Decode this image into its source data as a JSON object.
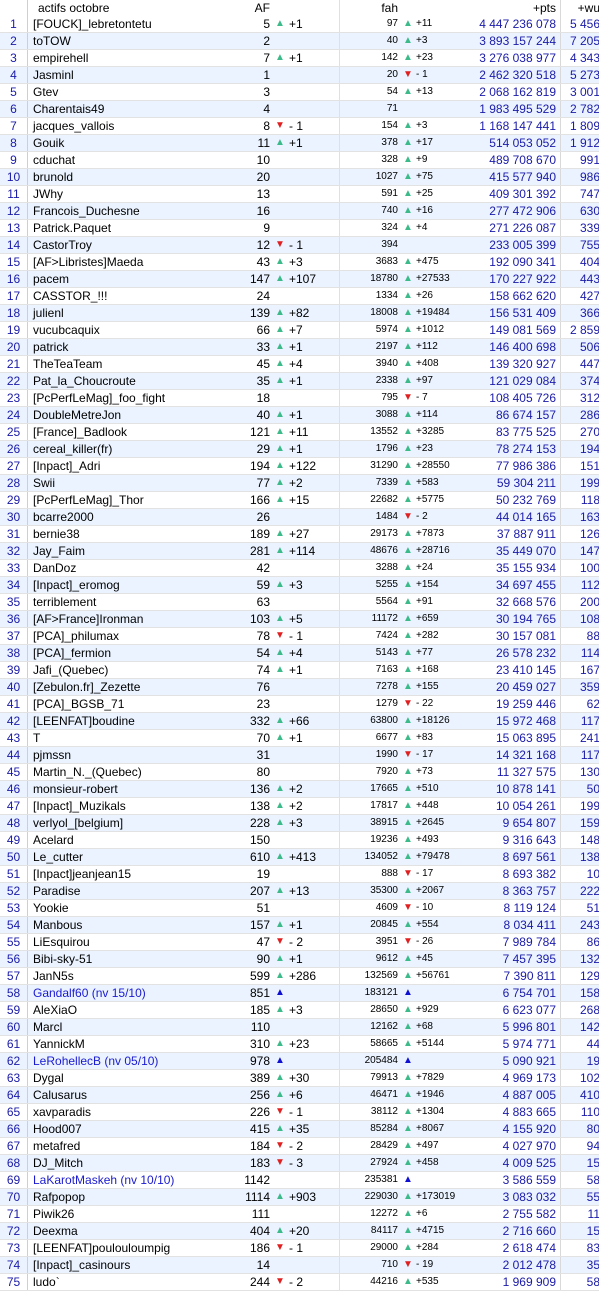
{
  "header": {
    "col_actifs": "actifs octobre",
    "col_af": "AF",
    "col_fah": "fah",
    "col_pts": "+pts",
    "col_wu": "+wu"
  },
  "rows": [
    {
      "r": "1",
      "n": "[FOUCK]_lebretontetu",
      "af": "5",
      "afa": "up",
      "afd": "+1",
      "f": "97",
      "fa": "up",
      "fd": "+11",
      "p": "4 447 236 078",
      "w": "5 456"
    },
    {
      "r": "2",
      "n": "toTOW",
      "af": "2",
      "afa": "",
      "afd": "",
      "f": "40",
      "fa": "up",
      "fd": "+3",
      "p": "3 893 157 244",
      "w": "7 205"
    },
    {
      "r": "3",
      "n": "empirehell",
      "af": "7",
      "afa": "up",
      "afd": "+1",
      "f": "142",
      "fa": "up",
      "fd": "+23",
      "p": "3 276 038 977",
      "w": "4 343"
    },
    {
      "r": "4",
      "n": "Jasminl",
      "af": "1",
      "afa": "",
      "afd": "",
      "f": "20",
      "fa": "down",
      "fd": "- 1",
      "p": "2 462 320 518",
      "w": "5 273"
    },
    {
      "r": "5",
      "n": "Gtev",
      "af": "3",
      "afa": "",
      "afd": "",
      "f": "54",
      "fa": "up",
      "fd": "+13",
      "p": "2 068 162 819",
      "w": "3 001"
    },
    {
      "r": "6",
      "n": "Charentais49",
      "af": "4",
      "afa": "",
      "afd": "",
      "f": "71",
      "fa": "",
      "fd": "",
      "p": "1 983 495 529",
      "w": "2 782"
    },
    {
      "r": "7",
      "n": "jacques_vallois",
      "af": "8",
      "afa": "down",
      "afd": "- 1",
      "f": "154",
      "fa": "up",
      "fd": "+3",
      "p": "1 168 147 441",
      "w": "1 809"
    },
    {
      "r": "8",
      "n": "Gouik",
      "af": "11",
      "afa": "up",
      "afd": "+1",
      "f": "378",
      "fa": "up",
      "fd": "+17",
      "p": "514 053 052",
      "w": "1 912"
    },
    {
      "r": "9",
      "n": "cduchat",
      "af": "10",
      "afa": "",
      "afd": "",
      "f": "328",
      "fa": "up",
      "fd": "+9",
      "p": "489 708 670",
      "w": "991"
    },
    {
      "r": "10",
      "n": "brunold",
      "af": "20",
      "afa": "",
      "afd": "",
      "f": "1027",
      "fa": "up",
      "fd": "+75",
      "p": "415 577 940",
      "w": "986"
    },
    {
      "r": "11",
      "n": "JWhy",
      "af": "13",
      "afa": "",
      "afd": "",
      "f": "591",
      "fa": "up",
      "fd": "+25",
      "p": "409 301 392",
      "w": "747"
    },
    {
      "r": "12",
      "n": "Francois_Duchesne",
      "af": "16",
      "afa": "",
      "afd": "",
      "f": "740",
      "fa": "up",
      "fd": "+16",
      "p": "277 472 906",
      "w": "630"
    },
    {
      "r": "13",
      "n": "Patrick.Paquet",
      "af": "9",
      "afa": "",
      "afd": "",
      "f": "324",
      "fa": "up",
      "fd": "+4",
      "p": "271 226 087",
      "w": "339"
    },
    {
      "r": "14",
      "n": "CastorTroy",
      "af": "12",
      "afa": "down",
      "afd": "- 1",
      "f": "394",
      "fa": "",
      "fd": "",
      "p": "233 005 399",
      "w": "755"
    },
    {
      "r": "15",
      "n": "[AF>Libristes]Maeda",
      "af": "43",
      "afa": "up",
      "afd": "+3",
      "f": "3683",
      "fa": "up",
      "fd": "+475",
      "p": "192 090 341",
      "w": "404"
    },
    {
      "r": "16",
      "n": "pacem",
      "af": "147",
      "afa": "up",
      "afd": "+107",
      "f": "18780",
      "fa": "up",
      "fd": "+27533",
      "p": "170 227 922",
      "w": "443"
    },
    {
      "r": "17",
      "n": "CASSTOR_!!!",
      "af": "24",
      "afa": "",
      "afd": "",
      "f": "1334",
      "fa": "up",
      "fd": "+26",
      "p": "158 662 620",
      "w": "427"
    },
    {
      "r": "18",
      "n": "julienl",
      "af": "139",
      "afa": "up",
      "afd": "+82",
      "f": "18008",
      "fa": "up",
      "fd": "+19484",
      "p": "156 531 409",
      "w": "366"
    },
    {
      "r": "19",
      "n": "vucubcaquix",
      "af": "66",
      "afa": "up",
      "afd": "+7",
      "f": "5974",
      "fa": "up",
      "fd": "+1012",
      "p": "149 081 569",
      "w": "2 859"
    },
    {
      "r": "20",
      "n": "patrick",
      "af": "33",
      "afa": "up",
      "afd": "+1",
      "f": "2197",
      "fa": "up",
      "fd": "+112",
      "p": "146 400 698",
      "w": "506"
    },
    {
      "r": "21",
      "n": "TheTeaTeam",
      "af": "45",
      "afa": "up",
      "afd": "+4",
      "f": "3940",
      "fa": "up",
      "fd": "+408",
      "p": "139 320 927",
      "w": "447"
    },
    {
      "r": "22",
      "n": "Pat_la_Choucroute",
      "af": "35",
      "afa": "up",
      "afd": "+1",
      "f": "2338",
      "fa": "up",
      "fd": "+97",
      "p": "121 029 084",
      "w": "374"
    },
    {
      "r": "23",
      "n": "[PcPerfLeMag]_foo_fight",
      "af": "18",
      "afa": "",
      "afd": "",
      "f": "795",
      "fa": "down",
      "fd": "- 7",
      "p": "108 405 726",
      "w": "312"
    },
    {
      "r": "24",
      "n": "DoubleMetreJon",
      "af": "40",
      "afa": "up",
      "afd": "+1",
      "f": "3088",
      "fa": "up",
      "fd": "+114",
      "p": "86 674 157",
      "w": "286"
    },
    {
      "r": "25",
      "n": "[France]_Badlook",
      "af": "121",
      "afa": "up",
      "afd": "+11",
      "f": "13552",
      "fa": "up",
      "fd": "+3285",
      "p": "83 775 525",
      "w": "270"
    },
    {
      "r": "26",
      "n": "cereal_killer(fr)",
      "af": "29",
      "afa": "up",
      "afd": "+1",
      "f": "1796",
      "fa": "up",
      "fd": "+23",
      "p": "78 274 153",
      "w": "194"
    },
    {
      "r": "27",
      "n": "[Inpact]_Adri",
      "af": "194",
      "afa": "up",
      "afd": "+122",
      "f": "31290",
      "fa": "up",
      "fd": "+28550",
      "p": "77 986 386",
      "w": "151"
    },
    {
      "r": "28",
      "n": "Swii",
      "af": "77",
      "afa": "up",
      "afd": "+2",
      "f": "7339",
      "fa": "up",
      "fd": "+583",
      "p": "59 304 211",
      "w": "199"
    },
    {
      "r": "29",
      "n": "[PcPerfLeMag]_Thor",
      "af": "166",
      "afa": "up",
      "afd": "+15",
      "f": "22682",
      "fa": "up",
      "fd": "+5775",
      "p": "50 232 769",
      "w": "118"
    },
    {
      "r": "30",
      "n": "bcarre2000",
      "af": "26",
      "afa": "",
      "afd": "",
      "f": "1484",
      "fa": "down",
      "fd": "- 2",
      "p": "44 014 165",
      "w": "163"
    },
    {
      "r": "31",
      "n": "bernie38",
      "af": "189",
      "afa": "up",
      "afd": "+27",
      "f": "29173",
      "fa": "up",
      "fd": "+7873",
      "p": "37 887 911",
      "w": "126"
    },
    {
      "r": "32",
      "n": "Jay_Faim",
      "af": "281",
      "afa": "up",
      "afd": "+114",
      "f": "48676",
      "fa": "up",
      "fd": "+28716",
      "p": "35 449 070",
      "w": "147"
    },
    {
      "r": "33",
      "n": "DanDoz",
      "af": "42",
      "afa": "",
      "afd": "",
      "f": "3288",
      "fa": "up",
      "fd": "+24",
      "p": "35 155 934",
      "w": "100"
    },
    {
      "r": "34",
      "n": "[Inpact]_eromog",
      "af": "59",
      "afa": "up",
      "afd": "+3",
      "f": "5255",
      "fa": "up",
      "fd": "+154",
      "p": "34 697 455",
      "w": "112"
    },
    {
      "r": "35",
      "n": "terriblement",
      "af": "63",
      "afa": "",
      "afd": "",
      "f": "5564",
      "fa": "up",
      "fd": "+91",
      "p": "32 668 576",
      "w": "200"
    },
    {
      "r": "36",
      "n": "[AF>France]Ironman",
      "af": "103",
      "afa": "up",
      "afd": "+5",
      "f": "11172",
      "fa": "up",
      "fd": "+659",
      "p": "30 194 765",
      "w": "108"
    },
    {
      "r": "37",
      "n": "[PCA]_philumax",
      "af": "78",
      "afa": "down",
      "afd": "- 1",
      "f": "7424",
      "fa": "up",
      "fd": "+282",
      "p": "30 157 081",
      "w": "88"
    },
    {
      "r": "38",
      "n": "[PCA]_fermion",
      "af": "54",
      "afa": "up",
      "afd": "+4",
      "f": "5143",
      "fa": "up",
      "fd": "+77",
      "p": "26 578 232",
      "w": "114"
    },
    {
      "r": "39",
      "n": "Jafi_(Quebec)",
      "af": "74",
      "afa": "up",
      "afd": "+1",
      "f": "7163",
      "fa": "up",
      "fd": "+168",
      "p": "23 410 145",
      "w": "167"
    },
    {
      "r": "40",
      "n": "[Zebulon.fr]_Zezette",
      "af": "76",
      "afa": "",
      "afd": "",
      "f": "7278",
      "fa": "up",
      "fd": "+155",
      "p": "20 459 027",
      "w": "359"
    },
    {
      "r": "41",
      "n": "[PCA]_BGSB_71",
      "af": "23",
      "afa": "",
      "afd": "",
      "f": "1279",
      "fa": "down",
      "fd": "- 22",
      "p": "19 259 446",
      "w": "62"
    },
    {
      "r": "42",
      "n": "[LEENFAT]boudine",
      "af": "332",
      "afa": "up",
      "afd": "+66",
      "f": "63800",
      "fa": "up",
      "fd": "+18126",
      "p": "15 972 468",
      "w": "117"
    },
    {
      "r": "43",
      "n": "T",
      "af": "70",
      "afa": "up",
      "afd": "+1",
      "f": "6677",
      "fa": "up",
      "fd": "+83",
      "p": "15 063 895",
      "w": "241"
    },
    {
      "r": "44",
      "n": "pjmssn",
      "af": "31",
      "afa": "",
      "afd": "",
      "f": "1990",
      "fa": "down",
      "fd": "- 17",
      "p": "14 321 168",
      "w": "117"
    },
    {
      "r": "45",
      "n": "Martin_N._(Quebec)",
      "af": "80",
      "afa": "",
      "afd": "",
      "f": "7920",
      "fa": "up",
      "fd": "+73",
      "p": "11 327 575",
      "w": "130"
    },
    {
      "r": "46",
      "n": "monsieur-robert",
      "af": "136",
      "afa": "up",
      "afd": "+2",
      "f": "17665",
      "fa": "up",
      "fd": "+510",
      "p": "10 878 141",
      "w": "50"
    },
    {
      "r": "47",
      "n": "[Inpact]_Muzikals",
      "af": "138",
      "afa": "up",
      "afd": "+2",
      "f": "17817",
      "fa": "up",
      "fd": "+448",
      "p": "10 054 261",
      "w": "199"
    },
    {
      "r": "48",
      "n": "verlyol_[belgium]",
      "af": "228",
      "afa": "up",
      "afd": "+3",
      "f": "38915",
      "fa": "up",
      "fd": "+2645",
      "p": "9 654 807",
      "w": "159"
    },
    {
      "r": "49",
      "n": "Acelard",
      "af": "150",
      "afa": "",
      "afd": "",
      "f": "19236",
      "fa": "up",
      "fd": "+493",
      "p": "9 316 643",
      "w": "148"
    },
    {
      "r": "50",
      "n": "Le_cutter",
      "af": "610",
      "afa": "up",
      "afd": "+413",
      "f": "134052",
      "fa": "up",
      "fd": "+79478",
      "p": "8 697 561",
      "w": "138"
    },
    {
      "r": "51",
      "n": "[Inpact]jeanjean15",
      "af": "19",
      "afa": "",
      "afd": "",
      "f": "888",
      "fa": "down",
      "fd": "- 17",
      "p": "8 693 382",
      "w": "10"
    },
    {
      "r": "52",
      "n": "Paradise",
      "af": "207",
      "afa": "up",
      "afd": "+13",
      "f": "35300",
      "fa": "up",
      "fd": "+2067",
      "p": "8 363 757",
      "w": "222"
    },
    {
      "r": "53",
      "n": "Yookie",
      "af": "51",
      "afa": "",
      "afd": "",
      "f": "4609",
      "fa": "down",
      "fd": "- 10",
      "p": "8 119 124",
      "w": "51"
    },
    {
      "r": "54",
      "n": "Manbous",
      "af": "157",
      "afa": "up",
      "afd": "+1",
      "f": "20845",
      "fa": "up",
      "fd": "+554",
      "p": "8 034 411",
      "w": "243"
    },
    {
      "r": "55",
      "n": "LiEsquirou",
      "af": "47",
      "afa": "down",
      "afd": "- 2",
      "f": "3951",
      "fa": "down",
      "fd": "- 26",
      "p": "7 989 784",
      "w": "86"
    },
    {
      "r": "56",
      "n": "Bibi-sky-51",
      "af": "90",
      "afa": "up",
      "afd": "+1",
      "f": "9612",
      "fa": "up",
      "fd": "+45",
      "p": "7 457 395",
      "w": "132"
    },
    {
      "r": "57",
      "n": "JanN5s",
      "af": "599",
      "afa": "up",
      "afd": "+286",
      "f": "132569",
      "fa": "up",
      "fd": "+56761",
      "p": "7 390 811",
      "w": "129"
    },
    {
      "r": "58",
      "n": "Gandalf60  (nv 15/10)",
      "nv": true,
      "af": "851",
      "afa": "new",
      "afd": "",
      "f": "183121",
      "fa": "new",
      "fd": "",
      "p": "6 754 701",
      "w": "158"
    },
    {
      "r": "59",
      "n": "AleXiaO",
      "af": "185",
      "afa": "up",
      "afd": "+3",
      "f": "28650",
      "fa": "up",
      "fd": "+929",
      "p": "6 623 077",
      "w": "268"
    },
    {
      "r": "60",
      "n": "Marcl",
      "af": "110",
      "afa": "",
      "afd": "",
      "f": "12162",
      "fa": "up",
      "fd": "+68",
      "p": "5 996 801",
      "w": "142"
    },
    {
      "r": "61",
      "n": "YannickM",
      "af": "310",
      "afa": "up",
      "afd": "+23",
      "f": "58665",
      "fa": "up",
      "fd": "+5144",
      "p": "5 974 771",
      "w": "44"
    },
    {
      "r": "62",
      "n": "LeRohellecB  (nv 05/10)",
      "nv": true,
      "af": "978",
      "afa": "new",
      "afd": "",
      "f": "205484",
      "fa": "new",
      "fd": "",
      "p": "5 090 921",
      "w": "19"
    },
    {
      "r": "63",
      "n": "Dygal",
      "af": "389",
      "afa": "up",
      "afd": "+30",
      "f": "79913",
      "fa": "up",
      "fd": "+7829",
      "p": "4 969 173",
      "w": "102"
    },
    {
      "r": "64",
      "n": "Calusarus",
      "af": "256",
      "afa": "up",
      "afd": "+6",
      "f": "46471",
      "fa": "up",
      "fd": "+1946",
      "p": "4 887 005",
      "w": "410"
    },
    {
      "r": "65",
      "n": "xavparadis",
      "af": "226",
      "afa": "down",
      "afd": "- 1",
      "f": "38112",
      "fa": "up",
      "fd": "+1304",
      "p": "4 883 665",
      "w": "110"
    },
    {
      "r": "66",
      "n": "Hood007",
      "af": "415",
      "afa": "up",
      "afd": "+35",
      "f": "85284",
      "fa": "up",
      "fd": "+8067",
      "p": "4 155 920",
      "w": "80"
    },
    {
      "r": "67",
      "n": "metafred",
      "af": "184",
      "afa": "down",
      "afd": "- 2",
      "f": "28429",
      "fa": "up",
      "fd": "+497",
      "p": "4 027 970",
      "w": "94"
    },
    {
      "r": "68",
      "n": "DJ_Mitch",
      "af": "183",
      "afa": "down",
      "afd": "- 3",
      "f": "27924",
      "fa": "up",
      "fd": "+458",
      "p": "4 009 525",
      "w": "15"
    },
    {
      "r": "69",
      "n": "LaKarotMaskeh  (nv 10/10)",
      "nv": true,
      "af": "1142",
      "afa": "",
      "afd": "",
      "f": "235381",
      "fa": "new",
      "fd": "",
      "p": "3 586 559",
      "w": "58"
    },
    {
      "r": "70",
      "n": "Rafpopop",
      "af": "1114",
      "afa": "up",
      "afd": "+903",
      "f": "229030",
      "fa": "up",
      "fd": "+173019",
      "p": "3 083 032",
      "w": "55"
    },
    {
      "r": "71",
      "n": "Piwik26",
      "af": "111",
      "afa": "",
      "afd": "",
      "f": "12272",
      "fa": "up",
      "fd": "+6",
      "p": "2 755 582",
      "w": "11"
    },
    {
      "r": "72",
      "n": "Deexma",
      "af": "404",
      "afa": "up",
      "afd": "+20",
      "f": "84117",
      "fa": "up",
      "fd": "+4715",
      "p": "2 716 660",
      "w": "15"
    },
    {
      "r": "73",
      "n": "[LEENFAT]poulouloumpig",
      "af": "186",
      "afa": "down",
      "afd": "- 1",
      "f": "29000",
      "fa": "up",
      "fd": "+284",
      "p": "2 618 474",
      "w": "83"
    },
    {
      "r": "74",
      "n": "[Inpact]_casinours",
      "af": "14",
      "afa": "",
      "afd": "",
      "f": "710",
      "fa": "down",
      "fd": "- 19",
      "p": "2 012 478",
      "w": "35"
    },
    {
      "r": "75",
      "n": "ludo`",
      "af": "244",
      "afa": "down",
      "afd": "- 2",
      "f": "44216",
      "fa": "up",
      "fd": "+535",
      "p": "1 969 909",
      "w": "58"
    }
  ]
}
